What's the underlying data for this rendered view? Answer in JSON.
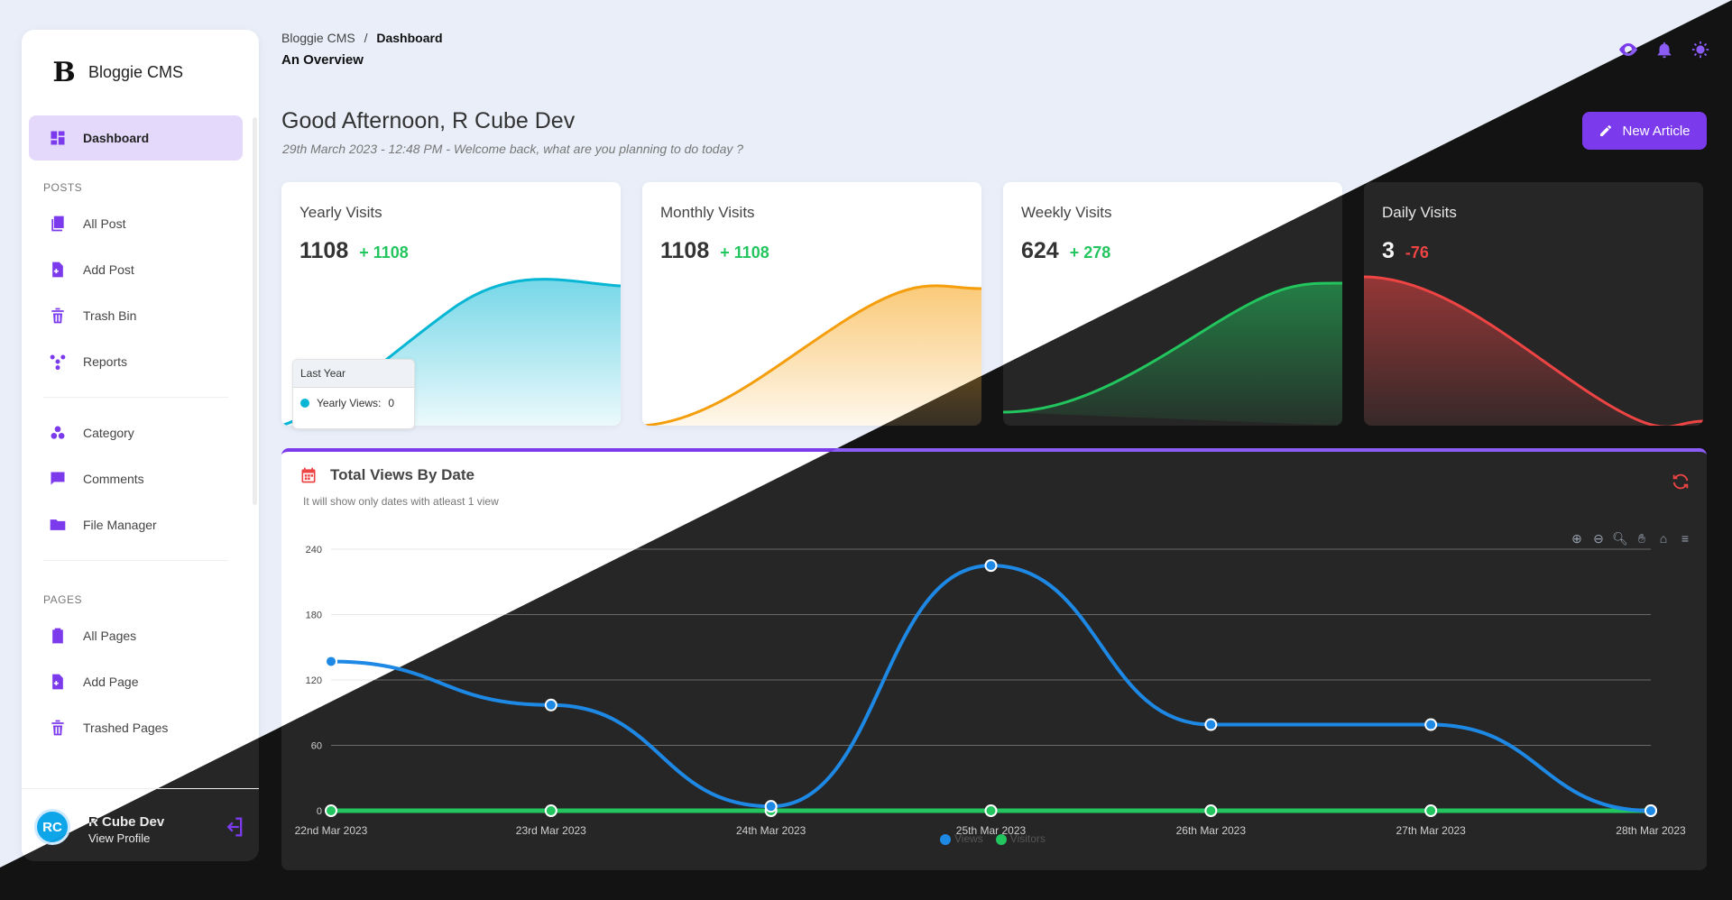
{
  "sidebar": {
    "brand": "Bloggie CMS",
    "brand_logo": "B",
    "items": [
      {
        "label": "Dashboard",
        "icon": "dashboard-icon",
        "active": true
      },
      {
        "section": "POSTS"
      },
      {
        "label": "All Post",
        "icon": "posts-icon"
      },
      {
        "label": "Add Post",
        "icon": "add-file-icon"
      },
      {
        "label": "Trash Bin",
        "icon": "trash-icon"
      },
      {
        "label": "Reports",
        "icon": "reports-icon"
      },
      {
        "label": "Category",
        "icon": "category-icon"
      },
      {
        "label": "Comments",
        "icon": "comments-icon"
      },
      {
        "label": "File Manager",
        "icon": "folder-icon"
      },
      {
        "section": "PAGES"
      },
      {
        "label": "All Pages",
        "icon": "pages-icon"
      },
      {
        "label": "Add Page",
        "icon": "add-page-icon"
      },
      {
        "label": "Trashed Pages",
        "icon": "trash-icon"
      }
    ],
    "user": {
      "initials": "RC",
      "name": "R Cube Dev",
      "link": "View Profile"
    }
  },
  "breadcrumb": {
    "root": "Bloggie CMS",
    "sep": "/",
    "current": "Dashboard",
    "sub": "An Overview"
  },
  "header": {
    "greeting": "Good Afternoon, R Cube Dev",
    "welcome": "29th March 2023 - 12:48 PM - Welcome back, what are you planning to do today ?",
    "new_article": "New Article"
  },
  "cards": [
    {
      "title": "Yearly Visits",
      "value": "1108",
      "delta": "+ 1108",
      "color": "#06b6d4"
    },
    {
      "title": "Monthly Visits",
      "value": "1108",
      "delta": "+ 1108",
      "color": "#f59e0b"
    },
    {
      "title": "Weekly Visits",
      "value": "624",
      "delta": "+ 278",
      "color": "#22c55e"
    },
    {
      "title": "Daily Visits",
      "value": "3",
      "delta": "-76",
      "color": "#ef4444"
    }
  ],
  "tooltip": {
    "head": "Last Year",
    "label": "Yearly Views:",
    "value": "0"
  },
  "chart_card": {
    "title": "Total Views By Date",
    "subtitle": "It will show only dates with atleast 1 view"
  },
  "colors": {
    "accent": "#7c3aed",
    "views": "#1e88e5",
    "visitors": "#22c55e"
  },
  "chart_data": {
    "type": "line",
    "x": [
      "22nd Mar 2023",
      "23rd Mar 2023",
      "24th Mar 2023",
      "25th Mar 2023",
      "26th Mar 2023",
      "27th Mar 2023",
      "28th Mar 2023"
    ],
    "series": [
      {
        "name": "Views",
        "values": [
          137,
          97,
          4,
          225,
          79,
          79,
          0
        ]
      },
      {
        "name": "Visitors",
        "values": [
          0,
          0,
          0,
          0,
          0,
          0,
          0
        ]
      }
    ],
    "yticks": [
      0,
      60,
      120,
      180,
      240
    ],
    "ylim": [
      0,
      240
    ],
    "grid": true,
    "legend": "bottom"
  }
}
